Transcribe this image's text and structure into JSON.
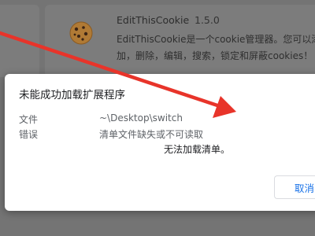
{
  "background": {
    "extension": {
      "name": "EditThisCookie",
      "version": "1.5.0",
      "icon": "cookie-icon",
      "description_line1": "EditThisCookie是一个cookie管理器。您可以添",
      "description_line2": "加，删除，编辑，搜索，锁定和屏蔽cookies！"
    }
  },
  "dialog": {
    "title": "未能成功加载扩展程序",
    "file_label": "文件",
    "file_value": "~\\Desktop\\switch",
    "error_label": "错误",
    "error_value_line1": "清单文件缺失或不可读取",
    "error_value_line2": "无法加载清单。",
    "cancel_label": "取消"
  },
  "colors": {
    "annotation_arrow": "#e8342a",
    "accent": "#1a73e8",
    "overlay": "#747474"
  }
}
